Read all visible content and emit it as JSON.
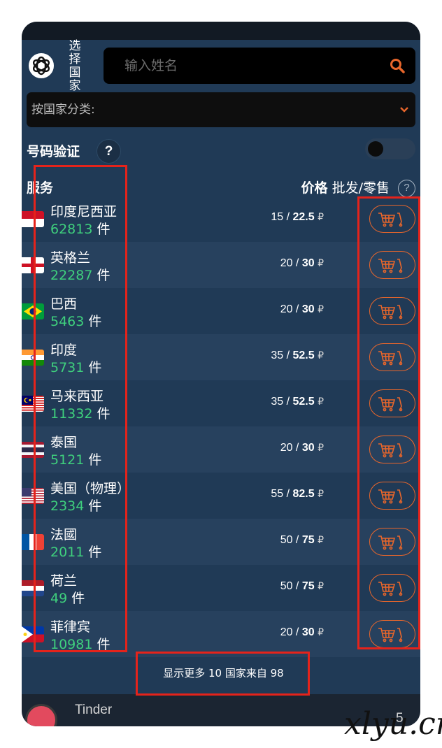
{
  "header": {
    "select_country_label": "选择国家",
    "search_placeholder": "输入姓名",
    "category_label": "按国家分类:"
  },
  "verification": {
    "label": "号码验证",
    "help": "?",
    "toggle_on": false
  },
  "columns": {
    "service": "服务",
    "price": "价格",
    "price_mode": "批发/零售",
    "help": "?"
  },
  "colors": {
    "background": "#203a56",
    "accent": "#e8662b",
    "count_green": "#3fd07d",
    "annotation_red": "#e5231b"
  },
  "countries": [
    {
      "name": "印度尼西亚",
      "count": "62813",
      "unit": "件",
      "wholesale": "15",
      "retail": "22.5",
      "currency": "₽",
      "flag": "indonesia"
    },
    {
      "name": "英格兰",
      "count": "22287",
      "unit": "件",
      "wholesale": "20",
      "retail": "30",
      "currency": "₽",
      "flag": "england"
    },
    {
      "name": "巴西",
      "count": "5463",
      "unit": "件",
      "wholesale": "20",
      "retail": "30",
      "currency": "₽",
      "flag": "brazil"
    },
    {
      "name": "印度",
      "count": "5731",
      "unit": "件",
      "wholesale": "35",
      "retail": "52.5",
      "currency": "₽",
      "flag": "india"
    },
    {
      "name": "马来西亚",
      "count": "11332",
      "unit": "件",
      "wholesale": "35",
      "retail": "52.5",
      "currency": "₽",
      "flag": "malaysia"
    },
    {
      "name": "泰国",
      "count": "5121",
      "unit": "件",
      "wholesale": "20",
      "retail": "30",
      "currency": "₽",
      "flag": "thailand"
    },
    {
      "name": "美国（物理）",
      "count": "2334",
      "unit": "件",
      "wholesale": "55",
      "retail": "82.5",
      "currency": "₽",
      "flag": "usa"
    },
    {
      "name": "法國",
      "count": "2011",
      "unit": "件",
      "wholesale": "50",
      "retail": "75",
      "currency": "₽",
      "flag": "france"
    },
    {
      "name": "荷兰",
      "count": "49",
      "unit": "件",
      "wholesale": "50",
      "retail": "75",
      "currency": "₽",
      "flag": "netherlands"
    },
    {
      "name": "菲律宾",
      "count": "10981",
      "unit": "件",
      "wholesale": "20",
      "retail": "30",
      "currency": "₽",
      "flag": "philippines"
    }
  ],
  "show_more": "显示更多 10 国家来自 98",
  "next_service": {
    "name": "Tinder",
    "price_partial": "5"
  },
  "watermark": "xlyu.cn",
  "icons": {
    "logo": "openai-logo-icon",
    "search": "search-icon",
    "dropdown": "chevron-down-icon",
    "cart": "cart-icon"
  }
}
